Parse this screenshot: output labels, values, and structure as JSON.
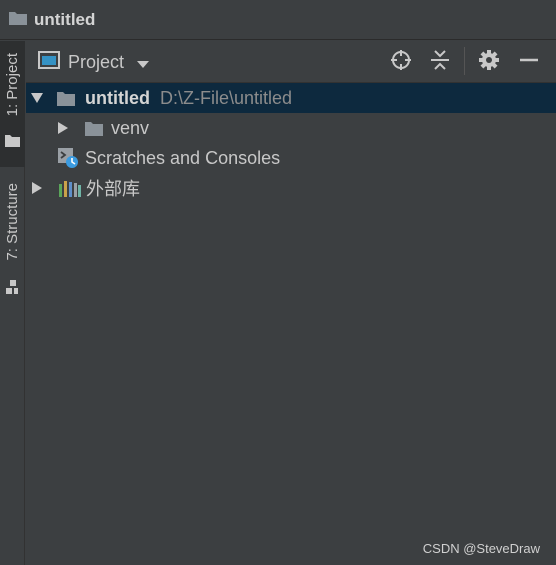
{
  "window": {
    "title": "untitled",
    "title_icon": "folder-icon"
  },
  "toolstrip": {
    "project_tab": {
      "label": "1: Project",
      "icon": "folder-icon"
    },
    "structure_tab": {
      "label": "7: Structure",
      "icon": "structure-icon"
    }
  },
  "panel": {
    "view_selector": {
      "label": "Project",
      "icon": "project-view-icon"
    },
    "actions": [
      {
        "name": "locate",
        "icon": "crosshair-icon"
      },
      {
        "name": "collapse-all",
        "icon": "collapse-all-icon"
      },
      {
        "name": "settings",
        "icon": "gear-icon"
      },
      {
        "name": "hide",
        "icon": "minimize-icon"
      }
    ]
  },
  "tree": {
    "root": {
      "name": "untitled",
      "path": "D:\\Z-File\\untitled",
      "expanded": true,
      "selected": true
    },
    "venv": {
      "name": "venv",
      "expanded": false
    },
    "scratches": {
      "name": "Scratches and Consoles"
    },
    "external_libs": {
      "name": "外部库",
      "expanded": false
    }
  },
  "watermark": "CSDN @SteveDraw",
  "colors": {
    "background": "#3c3f41",
    "selection": "#0d293e",
    "folder": "#8a9299",
    "text": "#c8c8c8",
    "path_text": "#8c8c8c"
  }
}
